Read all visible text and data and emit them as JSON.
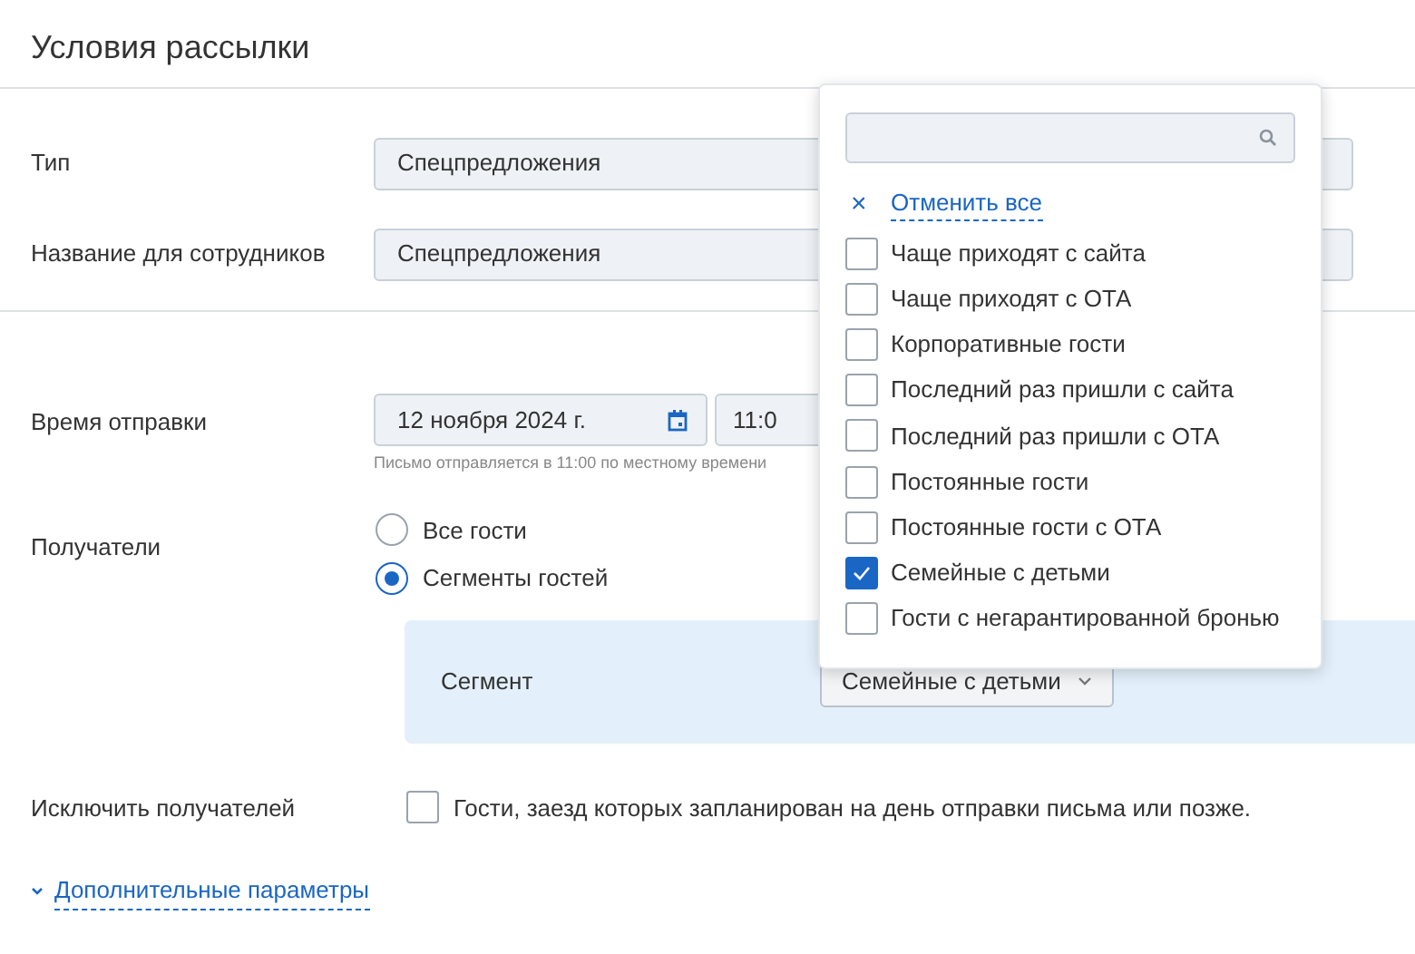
{
  "title": "Условия рассылки",
  "fields": [
    {
      "label": "Тип",
      "value": "Спецпредложения"
    },
    {
      "label": "Название для сотрудников",
      "value": "Спецпредложения"
    }
  ],
  "send_time": {
    "label": "Время отправки",
    "date": "12 ноября 2024 г.",
    "time": "11:0",
    "hint": "Письмо отправляется в 11:00 по местному времени"
  },
  "recipients": {
    "label": "Получатели",
    "options": [
      {
        "label": "Все гости",
        "selected": false
      },
      {
        "label": "Сегменты гостей",
        "selected": true
      }
    ],
    "segment": {
      "label": "Сегмент",
      "value": "Семейные с детьми"
    }
  },
  "exclude": {
    "label": "Исключить получателей",
    "option": "Гости, заезд которых запланирован на день отправки письма или позже.",
    "checked": false
  },
  "more_link": "Дополнительные параметры",
  "dropdown": {
    "clear_icon": "×",
    "clear_label": "Отменить все",
    "items": [
      {
        "label": "Чаще приходят с сайта",
        "checked": false
      },
      {
        "label": "Чаще приходят с ОТА",
        "checked": false
      },
      {
        "label": "Корпоративные гости",
        "checked": false
      },
      {
        "label": "Последний раз пришли с сайта",
        "checked": false
      },
      {
        "label": "Последний раз пришли с ОТА",
        "checked": false
      },
      {
        "label": "Постоянные гости",
        "checked": false
      },
      {
        "label": "Постоянные гости с ОТА",
        "checked": false
      },
      {
        "label": "Семейные с детьми",
        "checked": true
      },
      {
        "label": "Гости с негарантированной бронью",
        "checked": false
      }
    ]
  }
}
